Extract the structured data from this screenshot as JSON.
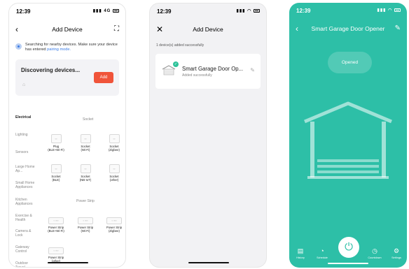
{
  "screens": {
    "add_device": {
      "time": "12:39",
      "signal": "4G",
      "title": "Add Device",
      "search_text": "Searching for nearby devices. Make sure your device has entered",
      "search_link": "pairing mode.",
      "discovering_label": "Discovering devices...",
      "add_button": "Add",
      "categories": [
        "Electrical",
        "Lighting",
        "Sensors",
        "Large Home Ap...",
        "Small Home Appliances",
        "Kitchen Appliances",
        "Exercise & Health",
        "Camera & Lock",
        "Gateway Control",
        "Outdoor Travel"
      ],
      "section_socket": "Socket",
      "section_power_strip": "Power Strip",
      "sockets": [
        {
          "name": "Plug",
          "sub": "(BLE+Wi-Fi)"
        },
        {
          "name": "Socket",
          "sub": "(Wi-Fi)"
        },
        {
          "name": "Socket",
          "sub": "(Zigbee)"
        },
        {
          "name": "Socket",
          "sub": "(BLE)"
        },
        {
          "name": "Socket",
          "sub": "(NB-IoT)"
        },
        {
          "name": "Socket",
          "sub": "(other)"
        }
      ],
      "strips": [
        {
          "name": "Power Strip",
          "sub": "(BLE+Wi-Fi)"
        },
        {
          "name": "Power Strip",
          "sub": "(Wi-Fi)"
        },
        {
          "name": "Power Strip",
          "sub": "(Zigbee)"
        },
        {
          "name": "Power Strip",
          "sub": "(other)"
        }
      ]
    },
    "added": {
      "time": "12:39",
      "title": "Add Device",
      "success_note": "1 device(s) added successfully",
      "device_name": "Smart Garage Door Op...",
      "device_status": "Added successfully"
    },
    "control": {
      "time": "12:39",
      "title": "Smart Garage Door Opener",
      "state": "Opened",
      "tabs": [
        "History",
        "Schedule",
        "Countdown",
        "Settings"
      ]
    }
  },
  "colors": {
    "accent_red": "#f0543a",
    "teal": "#2dbfa7",
    "link_blue": "#3a7be5",
    "success_green": "#2fc39a"
  }
}
